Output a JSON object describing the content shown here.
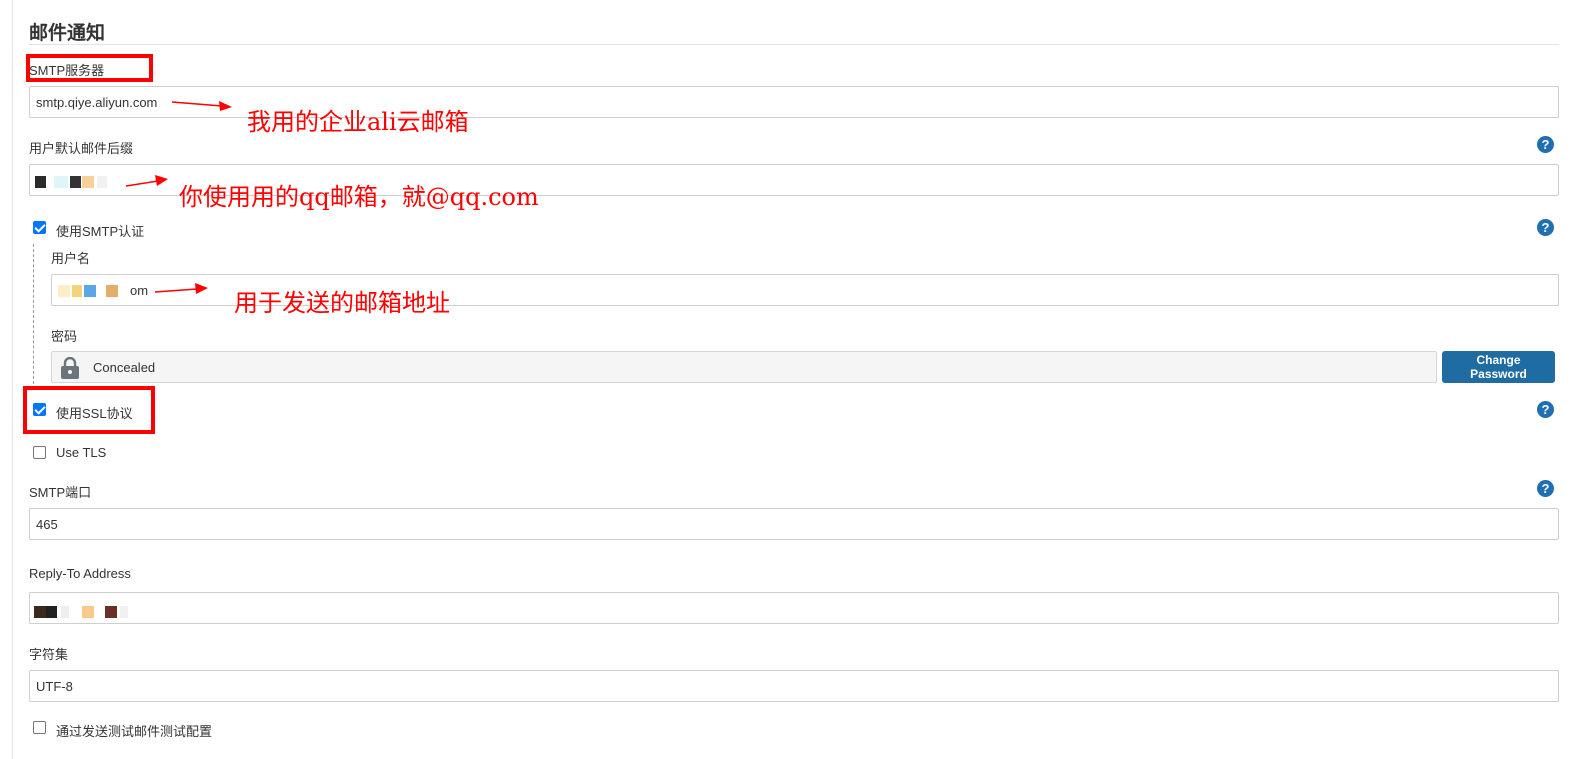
{
  "section": {
    "title": "邮件通知"
  },
  "smtp_server": {
    "label": "SMTP服务器",
    "value": "smtp.qiye.aliyun.com"
  },
  "default_suffix": {
    "label": "用户默认邮件后缀",
    "value": ""
  },
  "smtp_auth": {
    "label": "使用SMTP认证",
    "checked": true,
    "username": {
      "label": "用户名",
      "value": "om"
    },
    "password": {
      "label": "密码",
      "concealed_text": "Concealed",
      "change_button": "Change Password"
    }
  },
  "use_ssl": {
    "label": "使用SSL协议",
    "checked": true
  },
  "use_tls": {
    "label": "Use TLS",
    "checked": false
  },
  "smtp_port": {
    "label": "SMTP端口",
    "value": "465"
  },
  "reply_to": {
    "label": "Reply-To Address",
    "value": ""
  },
  "charset": {
    "label": "字符集",
    "value": "UTF-8"
  },
  "test_config": {
    "label": "通过发送测试邮件测试配置",
    "checked": false
  },
  "help": {
    "symbol": "?"
  },
  "annotations": {
    "server_note": "我用的企业ali云邮箱",
    "suffix_note": "你使用用的qq邮箱，就@qq.com",
    "username_note": "用于发送的邮箱地址"
  },
  "colors": {
    "accent": "#1f6ca3",
    "annotation": "#ff0000",
    "checkbox": "#0075ff"
  }
}
